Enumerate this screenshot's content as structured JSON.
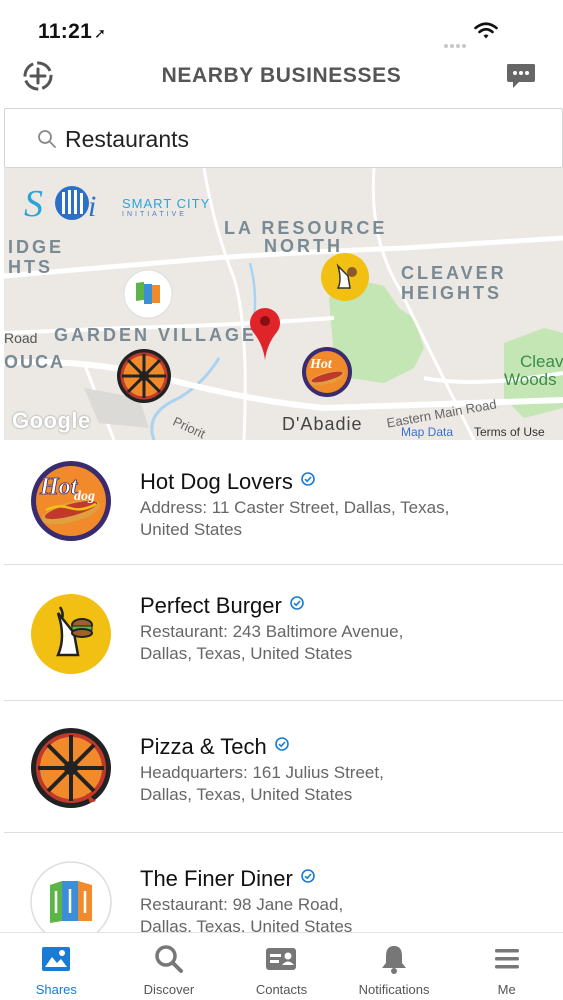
{
  "status_bar": {
    "time": "11:21",
    "location_arrow": "➚"
  },
  "header": {
    "title": "NEARBY BUSINESSES",
    "left_icon": "add-circle-icon",
    "right_icon": "chat-icon"
  },
  "search": {
    "value": "Restaurants",
    "placeholder": "Search"
  },
  "map": {
    "brand_title": "SMART CITY",
    "brand_subtitle": "INITIATIVE",
    "labels": {
      "la_resource_1": "LA RESOURCE",
      "la_resource_2": "NORTH",
      "cleaver_1": "CLEAVER",
      "cleaver_2": "HEIGHTS",
      "ridge_1": "IDGE",
      "ridge_2": "HTS",
      "garden_village": "GARDEN VILLAGE",
      "road": "Road",
      "ouca": "OUCA",
      "cleav_woods_1": "Cleav",
      "cleav_woods_2": "Woods",
      "dabadie": "D'Abadie",
      "eastern_main_road": "Eastern Main Road",
      "priority": "Priorit"
    },
    "google": "Google",
    "map_data": "Map Data",
    "terms": "Terms of Use",
    "colors": {
      "park": "#c3e6b4",
      "road": "#ffffff",
      "water": "#aad3f2",
      "pin": "#e0252a"
    }
  },
  "businesses": [
    {
      "name": "Hot Dog Lovers",
      "address_line1": "Address: 11 Caster Street, Dallas, Texas,",
      "address_line2": "United States",
      "logo": "hotdog-logo"
    },
    {
      "name": "Perfect Burger",
      "address_line1": "Restaurant: 243 Baltimore Avenue,",
      "address_line2": "Dallas, Texas, United States",
      "logo": "burger-logo"
    },
    {
      "name": "Pizza & Tech",
      "address_line1": "Headquarters: 161 Julius Street,",
      "address_line2": "Dallas, Texas, United States",
      "logo": "pizza-logo"
    },
    {
      "name": "The Finer Diner",
      "address_line1": "Restaurant: 98 Jane Road,",
      "address_line2": "Dallas, Texas, United States",
      "logo": "diner-logo"
    }
  ],
  "bottom_nav": [
    {
      "label": "Shares",
      "icon": "image-icon",
      "active": true
    },
    {
      "label": "Discover",
      "icon": "search-icon",
      "active": false
    },
    {
      "label": "Contacts",
      "icon": "contact-card-icon",
      "active": false
    },
    {
      "label": "Notifications",
      "icon": "bell-icon",
      "active": false
    },
    {
      "label": "Me",
      "icon": "menu-icon",
      "active": false
    }
  ],
  "colors": {
    "accent": "#1a7bd4",
    "verified": "#1a7bd4",
    "header_text": "#555555"
  }
}
